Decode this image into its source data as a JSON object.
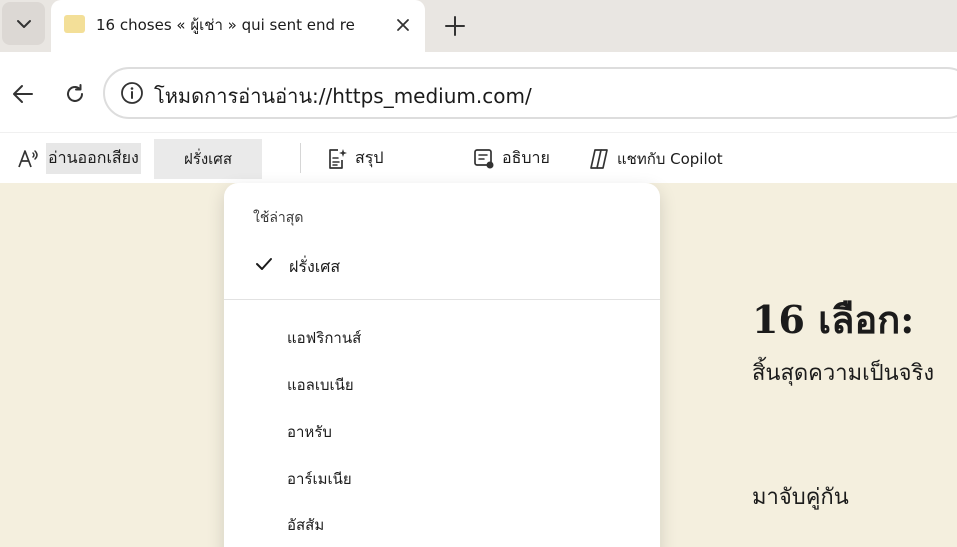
{
  "tab": {
    "title": "16 choses « ผู้เช่า » qui sent end re",
    "favicon": "page-favicon"
  },
  "address": {
    "url": "โหมดการอ่านอ่าน://https_medium.com/"
  },
  "reader_toolbar": {
    "read_aloud": "อ่านออกเสียง",
    "language": "ฝรั่งเศส",
    "summarize": "สรุป",
    "explain": "อธิบาย",
    "copilot": "แชทกับ Copilot"
  },
  "language_menu": {
    "recent_header": "ใช้ล่าสุด",
    "selected": "ฝรั่งเศส",
    "options": [
      "แอฟริกานส์",
      "แอลเบเนีย",
      "อาหรับ",
      "อาร์เมเนีย",
      "อัสสัม"
    ]
  },
  "article": {
    "title": "16 เลือก:",
    "subtitle": "สิ้นสุดความเป็นจริง",
    "heading2": "มาจับคู่กัน"
  },
  "colors": {
    "page_background": "#f4efde",
    "tab_strip": "#e9e6e2",
    "favicon": "#f3df98"
  }
}
